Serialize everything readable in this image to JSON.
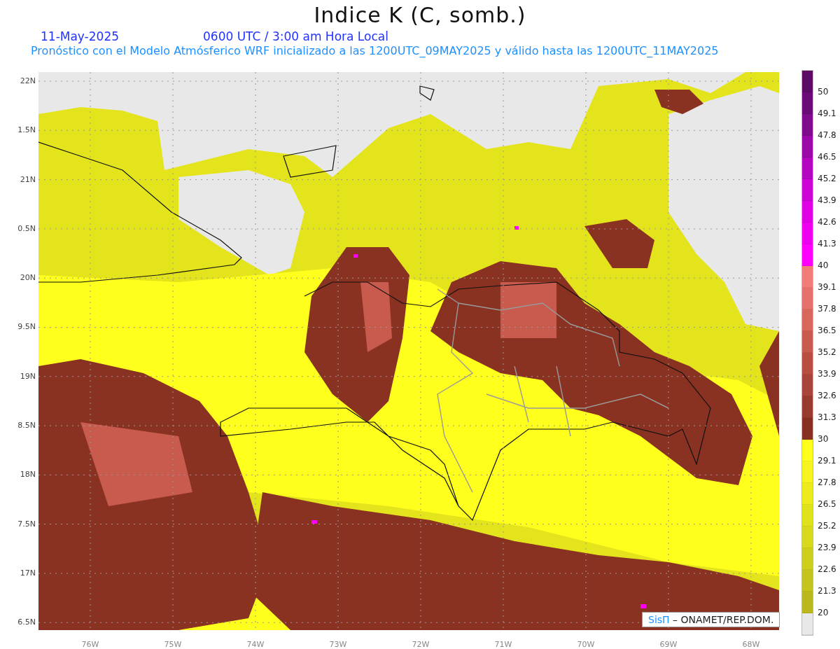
{
  "title": "Indice K (C, somb.)",
  "date": "11-May-2025",
  "time": "0600 UTC / 3:00 am Hora Local",
  "subtitle": "Pronóstico con el Modelo Atmósferico WRF inicializado a las 1200UTC_09MAY2025 y válido hasta las  1200UTC_11MAY2025",
  "y_labels": [
    "22N",
    "1.5N",
    "21N",
    "0.5N",
    "20N",
    "9.5N",
    "19N",
    "8.5N",
    "18N",
    "7.5N",
    "17N",
    "6.5N"
  ],
  "x_labels": [
    "76W",
    "75W",
    "74W",
    "73W",
    "72W",
    "71W",
    "70W",
    "69W",
    "68W"
  ],
  "credit": {
    "brand": "SisΠ",
    "text": "– ONAMET/REP.DOM."
  },
  "colorbar": [
    {
      "color": "#5c0a64",
      "label": "50"
    },
    {
      "color": "#6c0a78",
      "label": "49.1"
    },
    {
      "color": "#800a8c",
      "label": "47.8"
    },
    {
      "color": "#9a08a8",
      "label": "46.5"
    },
    {
      "color": "#b405c0",
      "label": "45.2"
    },
    {
      "color": "#cc04d4",
      "label": "43.9"
    },
    {
      "color": "#e002e4",
      "label": "42.6"
    },
    {
      "color": "#f000f0",
      "label": "41.3"
    },
    {
      "color": "#ff00ff",
      "label": "40"
    },
    {
      "color": "#f27c78",
      "label": "39.1"
    },
    {
      "color": "#e6706a",
      "label": "37.8"
    },
    {
      "color": "#d8665c",
      "label": "36.5"
    },
    {
      "color": "#c85a4e",
      "label": "35.2"
    },
    {
      "color": "#b84e42",
      "label": "33.9"
    },
    {
      "color": "#a84438",
      "label": "32.6"
    },
    {
      "color": "#983a2e",
      "label": "31.3"
    },
    {
      "color": "#883020",
      "label": "30"
    },
    {
      "color": "#ffff1e",
      "label": "29.1"
    },
    {
      "color": "#f6f41c",
      "label": "27.8"
    },
    {
      "color": "#ecec1c",
      "label": "26.5"
    },
    {
      "color": "#e2e21c",
      "label": "25.2"
    },
    {
      "color": "#d8d81c",
      "label": "23.9"
    },
    {
      "color": "#cece1c",
      "label": "22.6"
    },
    {
      "color": "#c4c41c",
      "label": "21.3"
    },
    {
      "color": "#bab81c",
      "label": "20"
    },
    {
      "color": "#e8e8e8"
    }
  ]
}
